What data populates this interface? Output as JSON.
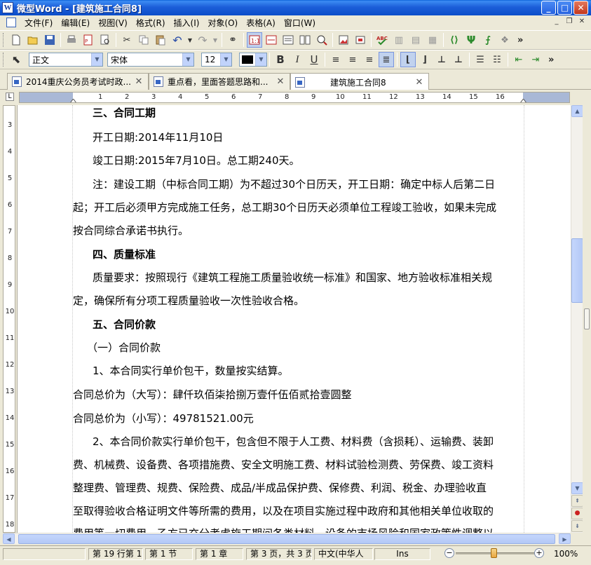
{
  "window": {
    "title": "微型Word - [建筑施工合同8]",
    "app_icon_letter": "W",
    "controls": [
      "minimize",
      "maximize",
      "close"
    ]
  },
  "menu": {
    "items": [
      "文件(F)",
      "编辑(E)",
      "视图(V)",
      "格式(R)",
      "插入(I)",
      "对象(O)",
      "表格(A)",
      "窗口(W)"
    ]
  },
  "format_toolbar": {
    "style_value": "正文",
    "font_value": "宋体",
    "size_value": "12",
    "font_color": "#000000"
  },
  "tabs": [
    {
      "label": "2014重庆公务员考试时政...",
      "active": false
    },
    {
      "label": "重点看，里面答题思路和...",
      "active": false
    },
    {
      "label": "建筑施工合同8",
      "active": true
    }
  ],
  "ruler": {
    "h_labels": [
      "1",
      "2",
      "3",
      "4",
      "5",
      "6",
      "7",
      "8",
      "9",
      "10",
      "11",
      "12",
      "13",
      "14",
      "15",
      "16"
    ],
    "v_labels": [
      "3",
      "4",
      "5",
      "6",
      "7",
      "8",
      "9",
      "10",
      "11",
      "12",
      "13",
      "14",
      "15",
      "16",
      "17",
      "18"
    ]
  },
  "document": {
    "lines": [
      {
        "text": "三、合同工期",
        "bold": true
      },
      {
        "text": "开工日期:2014年11月10日",
        "bold": false
      },
      {
        "text": "竣工日期:2015年7月10日。总工期240天。",
        "bold": false
      },
      {
        "text": "注：建设工期（中标合同工期）为不超过30个日历天，开工日期：确定中标人后第二日",
        "bold": false
      },
      {
        "text": "起；开工后必须甲方完成施工任务，总工期30个日历天必须单位工程竣工验收，如果未完成",
        "bold": false
      },
      {
        "text": "按合同综合承诺书执行。",
        "bold": false
      },
      {
        "text": "四、质量标准",
        "bold": true
      },
      {
        "text": "质量要求：按照现行《建筑工程施工质量验收统一标准》和国家、地方验收标准相关规",
        "bold": false
      },
      {
        "text": "定，确保所有分项工程质量验收一次性验收合格。",
        "bold": false
      },
      {
        "text": "五、合同价款",
        "bold": true
      },
      {
        "text": "（一）合同价款",
        "bold": false
      },
      {
        "text": "1、本合同实行单价包干，数量按实结算。",
        "bold": false
      },
      {
        "text": "合同总价为（大写）：肆仟玖佰柒拾捌万壹仟伍佰贰拾壹圆整",
        "bold": false
      },
      {
        "text": "合同总价为（小写）：49781521.00元",
        "bold": false
      },
      {
        "text": "2、本合同价款实行单价包干，包含但不限于人工费、材料费（含损耗）、运输费、装卸",
        "bold": false
      },
      {
        "text": "费、机械费、设备费、各项措施费、安全文明施工费、材料试验检测费、劳保费、竣工资料",
        "bold": false
      },
      {
        "text": "整理费、管理费、规费、保险费、成品/半成品保护费、保修费、利润、税金、办理验收直",
        "bold": false
      },
      {
        "text": "至取得验收合格证明文件等所需的费用，以及在项目实施过程中政府和其他相关单位收取的",
        "bold": false
      },
      {
        "text": "费用等一切费用，乙方已充分考虑施工期间各类材料、设备的市场风险和国家政策性调整以",
        "bold": false
      }
    ]
  },
  "status": {
    "pos": "第 19 行第 10",
    "section": "第 1 节",
    "chapter": "第 1 章",
    "pages": "第 3 页，共 3 页",
    "language": "中文(中华人",
    "mode": "Ins",
    "zoom": "100%"
  }
}
